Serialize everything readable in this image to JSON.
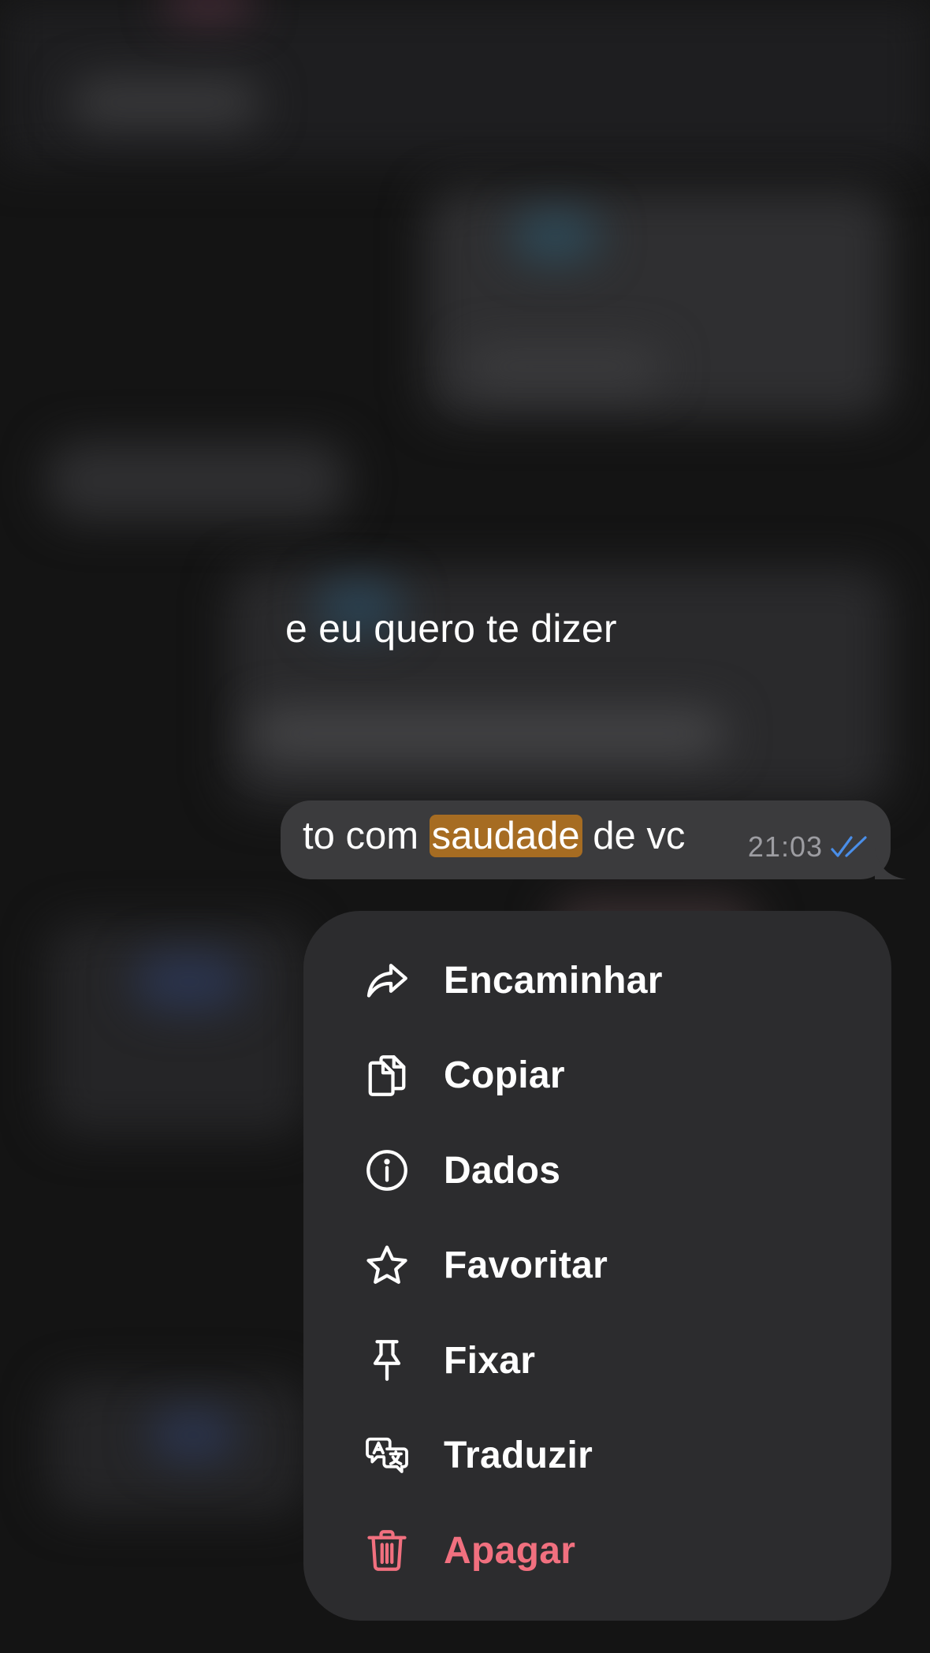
{
  "background_caption": "e eu quero te dizer",
  "message": {
    "text_before": "to com ",
    "highlighted_word": "saudade",
    "text_after": " de vc",
    "time": "21:03",
    "read_tick_color": "#4a8ee8",
    "highlight_color": "#a66c22"
  },
  "context_menu": {
    "items": [
      {
        "label": "Encaminhar",
        "icon": "forward-arrow-icon"
      },
      {
        "label": "Copiar",
        "icon": "copy-icon"
      },
      {
        "label": "Dados",
        "icon": "info-icon"
      },
      {
        "label": "Favoritar",
        "icon": "star-icon"
      },
      {
        "label": "Fixar",
        "icon": "pin-icon"
      },
      {
        "label": "Traduzir",
        "icon": "translate-icon"
      },
      {
        "label": "Apagar",
        "icon": "trash-icon",
        "destructive": true,
        "color": "#f1707f"
      }
    ]
  }
}
